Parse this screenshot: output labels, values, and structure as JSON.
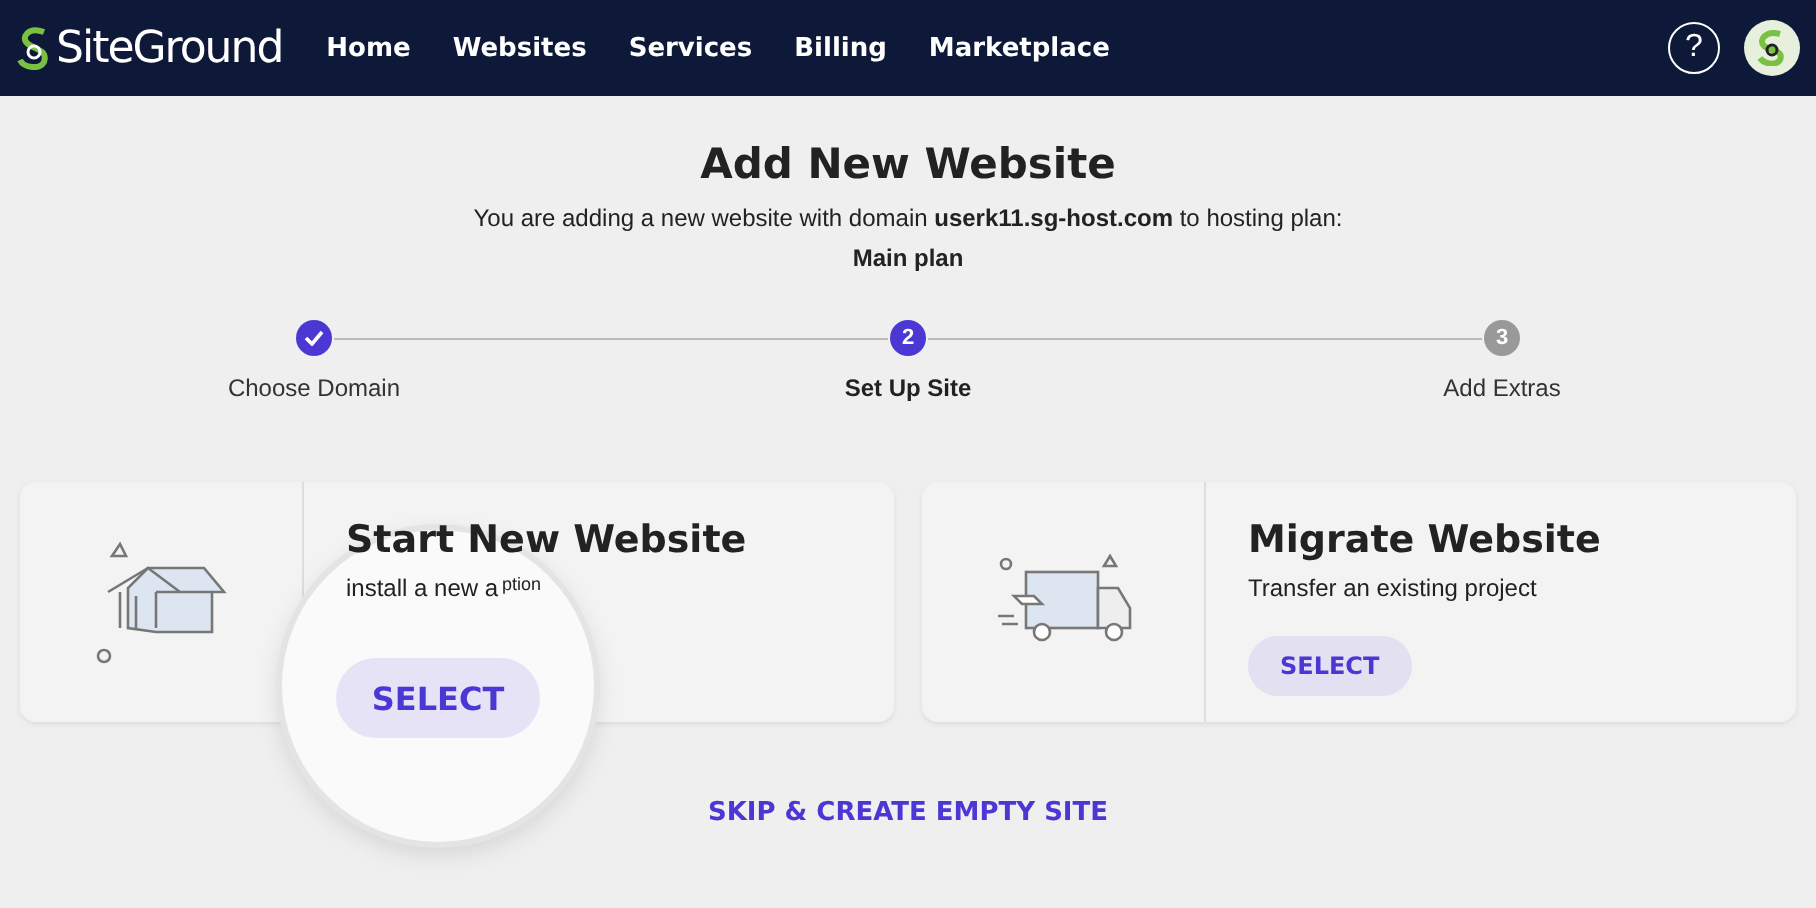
{
  "header": {
    "logo": "SiteGround",
    "nav": [
      {
        "label": "Home"
      },
      {
        "label": "Websites"
      },
      {
        "label": "Services"
      },
      {
        "label": "Billing"
      },
      {
        "label": "Marketplace"
      }
    ],
    "help": "?"
  },
  "title": "Add New Website",
  "intro": "You are adding a new website with domain **userk11.sg-host.com** to hosting plan:",
  "plan": "Main plan",
  "steps": [
    {
      "label": "Choose Domain",
      "done": true,
      "selected": false
    },
    {
      "label": "Set Up Site",
      "number": "2",
      "done": false,
      "selected": true
    },
    {
      "label": "Add Extras",
      "number": "3",
      "done": false,
      "selected": false
    }
  ],
  "cards": [
    {
      "kind": "house",
      "title": "Start New Website",
      "description": "install a new a",
      "lens_text": "ption",
      "button": "SELECT",
      "magnified": true
    },
    {
      "kind": "truck",
      "title": "Migrate Website",
      "description": "Transfer an existing project",
      "button": "SELECT",
      "magnified": false
    }
  ],
  "skip_link": "SKIP & CREATE EMPTY SITE"
}
